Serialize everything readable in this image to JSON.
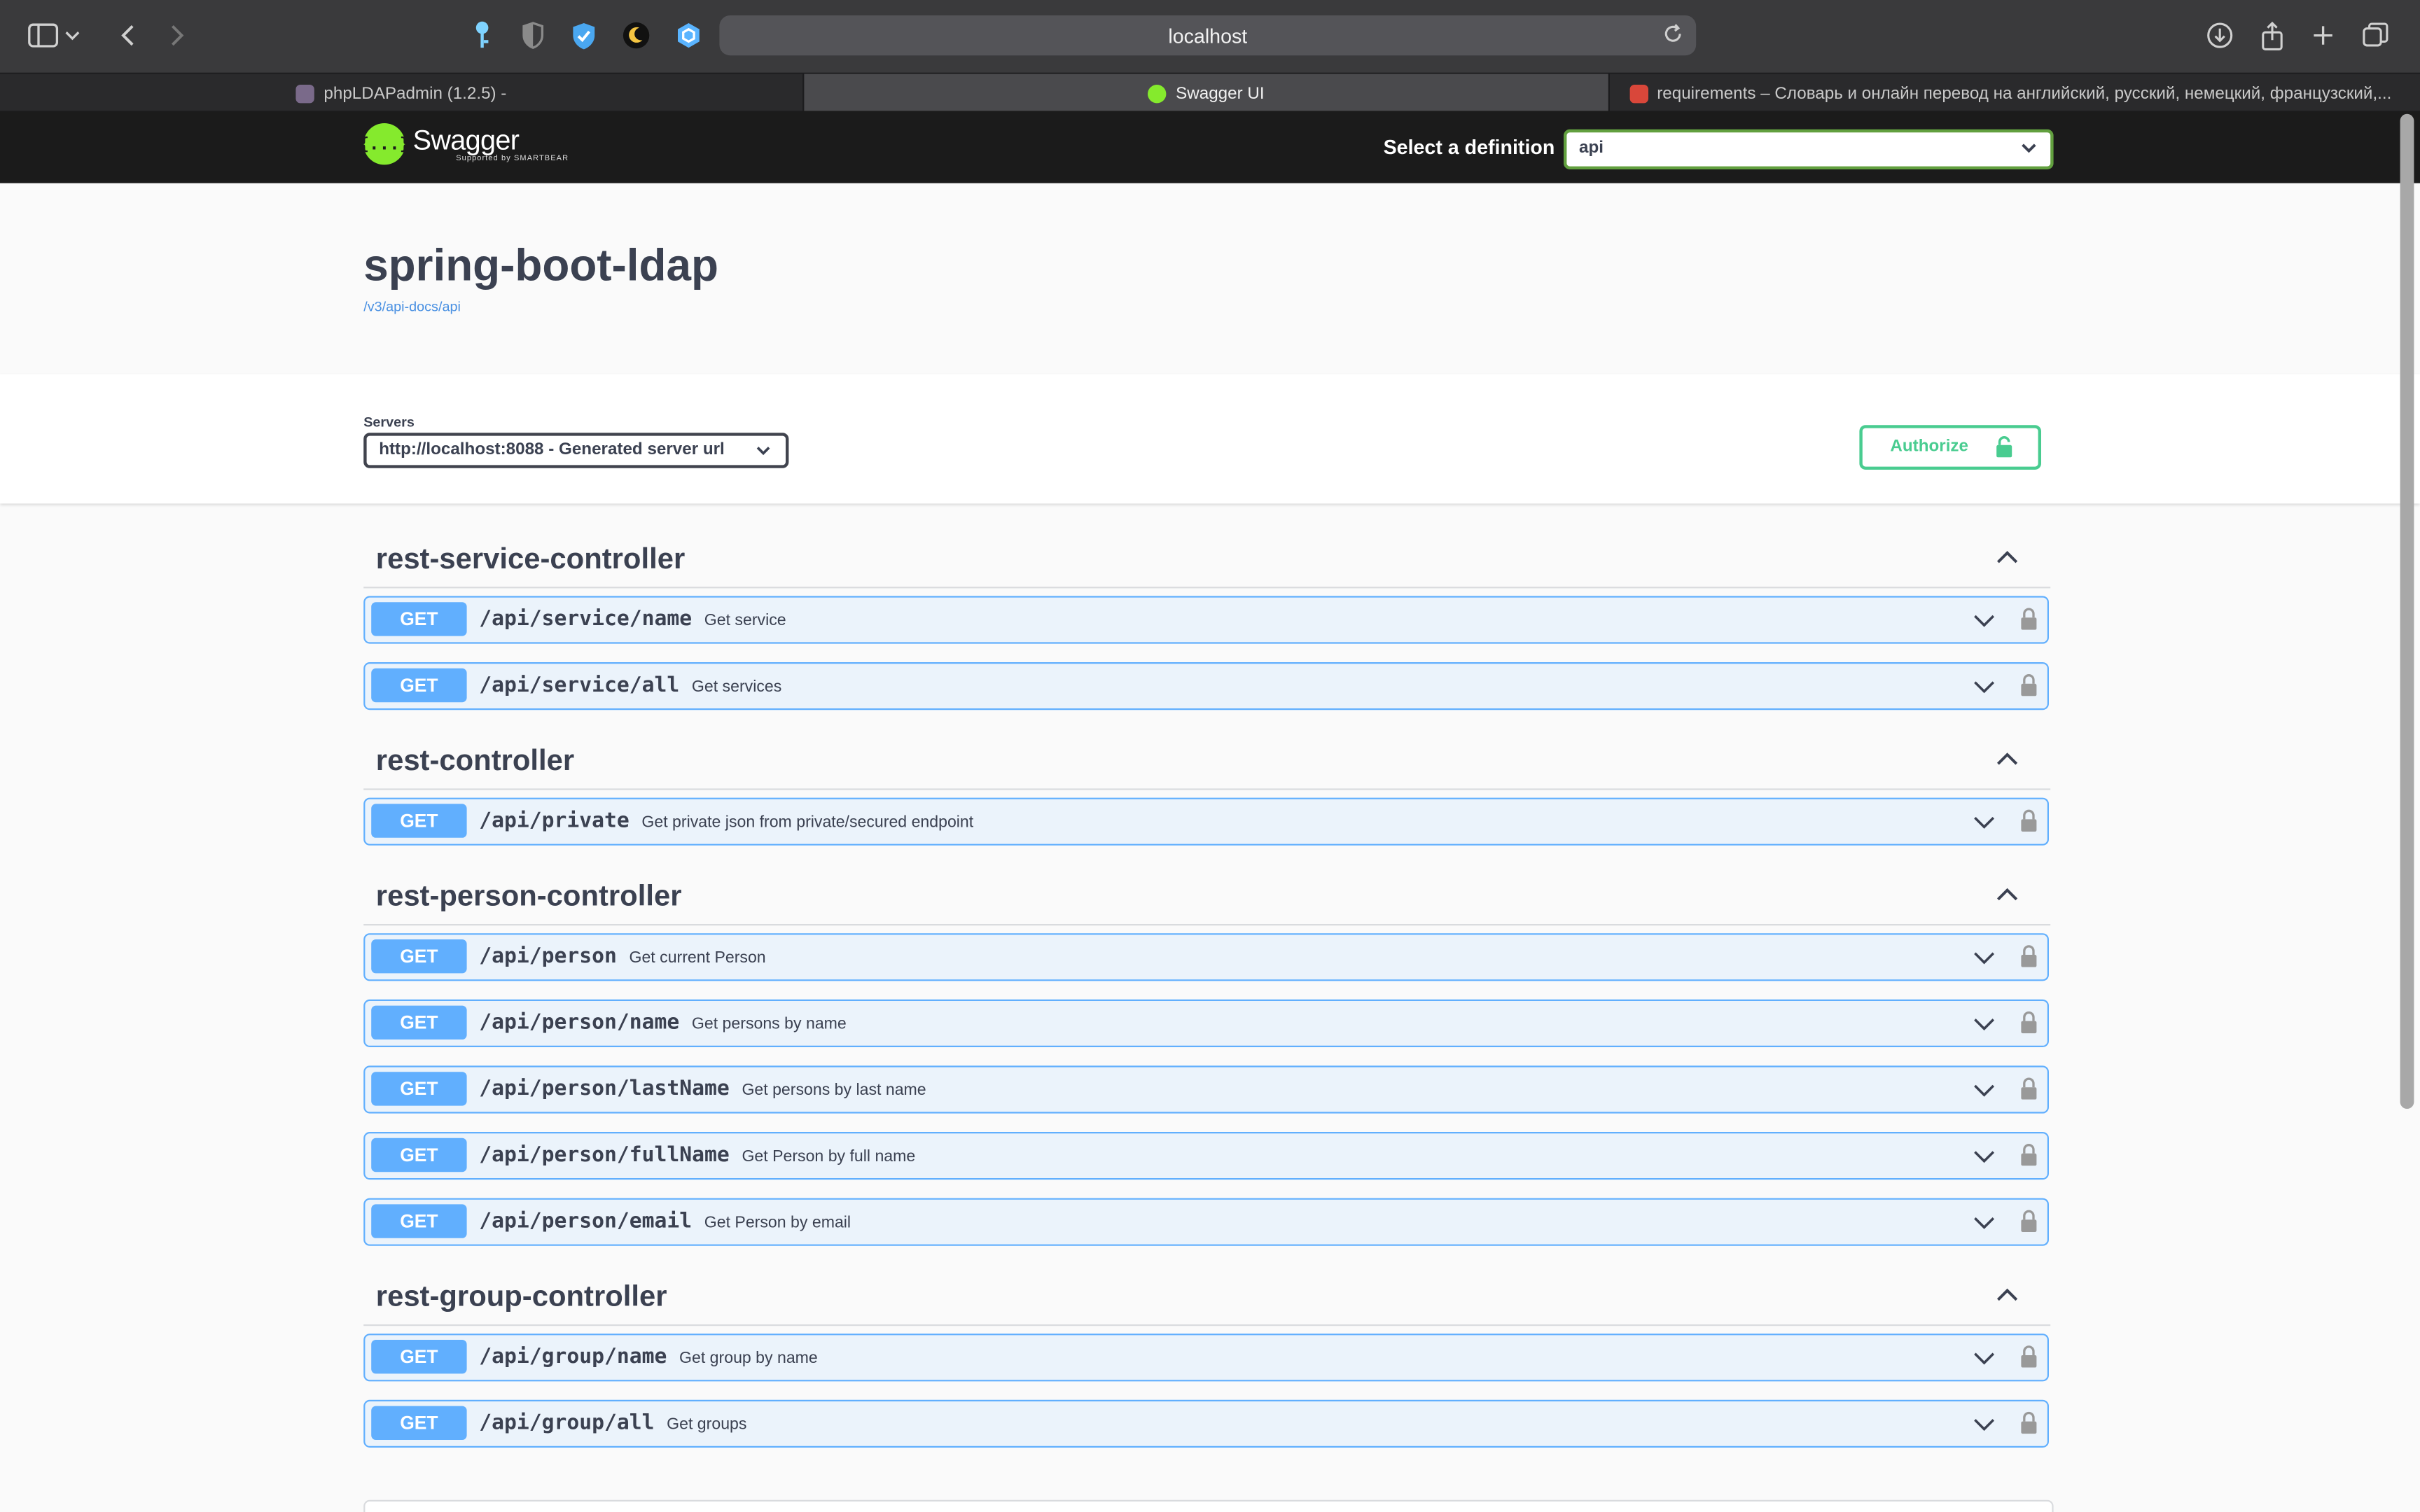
{
  "browser": {
    "url": "localhost",
    "tabs": [
      {
        "label": "phpLDAPadmin (1.2.5) -",
        "active": false
      },
      {
        "label": "Swagger UI",
        "active": true
      },
      {
        "label": "requirements – Словарь и онлайн перевод на английский, русский, немецкий, французский,...",
        "active": false
      }
    ]
  },
  "topbar": {
    "logo_text": "Swagger",
    "logo_sub": "Supported by SMARTBEAR",
    "logo_mark": "{...}",
    "definition_label": "Select a definition",
    "definition_value": "api"
  },
  "info": {
    "title": "spring-boot-ldap",
    "doc_link": "/v3/api-docs/api"
  },
  "scheme": {
    "servers_label": "Servers",
    "server_value": "http://localhost:8088 - Generated server url",
    "authorize_label": "Authorize"
  },
  "tags": [
    {
      "name": "rest-service-controller",
      "operations": [
        {
          "method": "GET",
          "path": "/api/service/name",
          "summary": "Get service"
        },
        {
          "method": "GET",
          "path": "/api/service/all",
          "summary": "Get services"
        }
      ]
    },
    {
      "name": "rest-controller",
      "operations": [
        {
          "method": "GET",
          "path": "/api/private",
          "summary": "Get private json from private/secured endpoint"
        }
      ]
    },
    {
      "name": "rest-person-controller",
      "operations": [
        {
          "method": "GET",
          "path": "/api/person",
          "summary": "Get current Person"
        },
        {
          "method": "GET",
          "path": "/api/person/name",
          "summary": "Get persons by name"
        },
        {
          "method": "GET",
          "path": "/api/person/lastName",
          "summary": "Get persons by last name"
        },
        {
          "method": "GET",
          "path": "/api/person/fullName",
          "summary": "Get Person by full name"
        },
        {
          "method": "GET",
          "path": "/api/person/email",
          "summary": "Get Person by email"
        }
      ]
    },
    {
      "name": "rest-group-controller",
      "operations": [
        {
          "method": "GET",
          "path": "/api/group/name",
          "summary": "Get group by name"
        },
        {
          "method": "GET",
          "path": "/api/group/all",
          "summary": "Get groups"
        }
      ]
    }
  ],
  "colors": {
    "get_accent": "#61affe",
    "get_bg": "#ebf3fb",
    "authorize": "#49cc90",
    "topbar_bg": "#1b1b1b",
    "logo_green": "#85ea2d"
  }
}
